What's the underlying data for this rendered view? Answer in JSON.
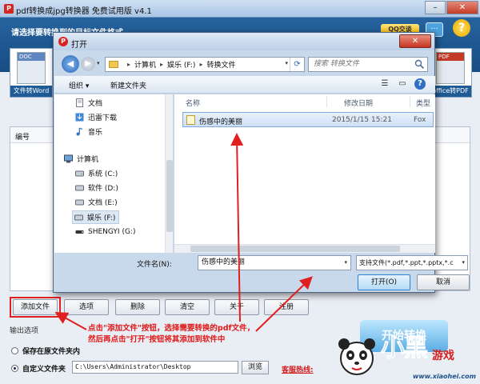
{
  "app": {
    "title": "pdf转换成jpg转换器 免费试用版 v4.1",
    "prompt": "请选择要转换到的目标文件格式",
    "qq_label": "QQ交谈",
    "tile_left_label": "文件转Word",
    "tile_left_badge": "DOC",
    "tile_right_label": "office转PDF",
    "tile_right_badge": "PDF",
    "list_column": "编号",
    "buttons": {
      "add_file": "添加文件",
      "options": "选项",
      "delete": "删除",
      "clear": "清空",
      "about": "关于",
      "register": "注册"
    },
    "output_options_label": "输出选项",
    "radio_keep_original": "保存在原文件夹内",
    "radio_custom_folder": "自定义文件夹",
    "output_path": "C:\\Users\\Administrator\\Desktop",
    "browse_label": "浏览",
    "hotline_label": "客服热线:",
    "start_label": "开始转换",
    "brand": {
      "text": "小黑",
      "text2": "游戏",
      "url": "www.xiaohei.com"
    }
  },
  "dialog": {
    "title": "打开",
    "breadcrumb": [
      "计算机",
      "娱乐 (F:)",
      "转换文件"
    ],
    "search_placeholder": "搜索 转换文件",
    "toolbar": {
      "organize": "组织 ▾",
      "new_folder": "新建文件夹"
    },
    "nav_items": [
      {
        "label": "文档",
        "icon": "document-icon"
      },
      {
        "label": "迅雷下载",
        "icon": "download-icon"
      },
      {
        "label": "音乐",
        "icon": "music-icon"
      },
      {
        "label": "计算机",
        "icon": "computer-icon"
      },
      {
        "label": "系统 (C:)",
        "icon": "drive-icon"
      },
      {
        "label": "软件 (D:)",
        "icon": "drive-icon"
      },
      {
        "label": "文档 (E:)",
        "icon": "drive-icon"
      },
      {
        "label": "娱乐 (F:)",
        "icon": "drive-icon"
      },
      {
        "label": "SHENGYI (G:)",
        "icon": "usb-drive-icon"
      }
    ],
    "columns": {
      "name": "名称",
      "modified": "修改日期",
      "type": "类型"
    },
    "files": [
      {
        "name": "伤感中的美丽",
        "modified": "2015/1/15 15:21",
        "type": "Fox"
      }
    ],
    "filename_label": "文件名(N):",
    "filename_value": "伤感中的美丽",
    "filetype_value": "支持文件(*.pdf,*.ppt,*.pptx,*.c",
    "open_label": "打开(O)",
    "cancel_label": "取消"
  },
  "annotation": {
    "line1": "点击\"添加文件\"按钮，选择需要转换的pdf文件，",
    "line2": "然后再点击\"打开\"按钮将其添加到软件中"
  },
  "colors": {
    "accent": "#1f5b95",
    "annotation": "#e01818",
    "hotline": "#d21a1a"
  }
}
